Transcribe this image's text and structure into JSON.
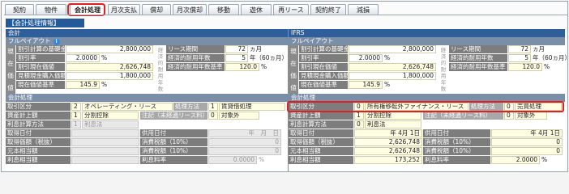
{
  "tabs": [
    "契約",
    "物件",
    "会計処理",
    "月次支払",
    "償却",
    "月次償却",
    "移動",
    "遊休",
    "再リース",
    "契約終了",
    "減損"
  ],
  "active_tab": 2,
  "panel_title": "【会計処理情報】",
  "left": {
    "header": "会計",
    "fullpayout": "フルペイアウト",
    "info_icon": "i",
    "side_label": [
      "現",
      "在",
      "価",
      "値"
    ],
    "rows": [
      {
        "label": "割引計算の基礎金額",
        "value": "2,800,000"
      },
      {
        "label": "割引率",
        "value": "2.0000",
        "unit": "%"
      },
      {
        "label": "割引現在価値",
        "value": "2,626,748"
      },
      {
        "label": "見積現金購入価額",
        "value": "1,800,000"
      },
      {
        "label": "現在価値基準",
        "value": "145.9",
        "unit": "%"
      }
    ],
    "vertical_col": [
      "経",
      "済",
      "的",
      "耐",
      "用",
      "年",
      "数"
    ],
    "right_rows": [
      {
        "label": "リース期間",
        "value": "72",
        "unit": "ヵ月"
      },
      {
        "label": "経済的耐用年数",
        "value": "5",
        "unit": "年（60ヵ月）"
      },
      {
        "label": "経済的耐用年数基準",
        "value": "120.0",
        "unit": "%"
      }
    ],
    "accounting_header": "会計処理",
    "acct_rows": [
      {
        "label": "取引区分",
        "code": "2",
        "value": "オペレーティング・リース",
        "label2": "処理方法",
        "code2": "1",
        "value2": "賃貸借処理"
      },
      {
        "label": "資産計上額",
        "code": "1",
        "value": "分割控除",
        "label2": "注記（未経過リース料）",
        "code2": "0",
        "value2": "対象外"
      },
      {
        "label": "利息計算方法",
        "code": "1",
        "value": "利息法"
      }
    ],
    "lower_rows": [
      {
        "label": "取得日付",
        "label2": "供用日付",
        "value2": "年　月　日"
      },
      {
        "label": "取得価額（税抜）",
        "label2": "消費税額（10%）",
        "value2": "0"
      },
      {
        "label": "元本相当額",
        "label2": "消費税額（10%）",
        "value2": "0"
      },
      {
        "label": "利息相当額",
        "label2": "利息料率",
        "value2": "0.0000",
        "unit2": "%"
      }
    ]
  },
  "right": {
    "header": "IFRS",
    "fullpayout": "フルペイアウト",
    "side_label": [
      "現",
      "在",
      "価",
      "値"
    ],
    "rows": [
      {
        "label": "割引計算の基礎金額",
        "value": "2,800,000"
      },
      {
        "label": "割引率",
        "value": "2.0000",
        "unit": "%"
      },
      {
        "label": "割引現在価値",
        "value": "2,626,748"
      },
      {
        "label": "見積現金購入価額",
        "value": "1,800,000"
      },
      {
        "label": "現在価値基準",
        "value": "145.9",
        "unit": "%"
      }
    ],
    "vertical_col": [
      "経",
      "済",
      "的",
      "耐",
      "用",
      "年",
      "数"
    ],
    "right_rows": [
      {
        "label": "リース期間",
        "value": "72",
        "unit": "ヵ月"
      },
      {
        "label": "経済的耐用年数",
        "value": "5",
        "unit": "年（60ヵ月）"
      },
      {
        "label": "経済的耐用年数基準",
        "value": "120.0",
        "unit": "%"
      }
    ],
    "accounting_header": "会計処理",
    "acct_rows": [
      {
        "label": "取引区分",
        "code": "0",
        "value": "所有権移転外ファイナンス・リース",
        "label2": "処理方法",
        "code2": "0",
        "value2": "売買処理"
      },
      {
        "label": "資産計上額",
        "code": "1",
        "value": "分割控除",
        "label2": "注記（未経過リース料）",
        "code2": "0",
        "value2": "対象外"
      },
      {
        "label": "利息計算方法",
        "code": "0",
        "value": "利息法"
      }
    ],
    "lower_rows": [
      {
        "label": "取得日付",
        "value": "年 4月 1日",
        "label2": "供用日付",
        "value2": "年 4月 1日"
      },
      {
        "label": "取得価額（税抜）",
        "value": "2,626,748",
        "label2": "消費税額（10%）",
        "value2": "0"
      },
      {
        "label": "元本相当額",
        "value": "2,626,748",
        "label2": "消費税額（10%）",
        "value2": "0"
      },
      {
        "label": "利息相当額",
        "value": "173,252",
        "label2": "利息料率",
        "value2": "2.0000",
        "unit2": "%"
      }
    ]
  },
  "colors": {
    "header_blue": "#2e5f9b",
    "subheader": "#7a8ea8",
    "label_gray": "#7d7d7d",
    "input_yellow": "#fffde4",
    "highlight_red": "#e02020"
  }
}
